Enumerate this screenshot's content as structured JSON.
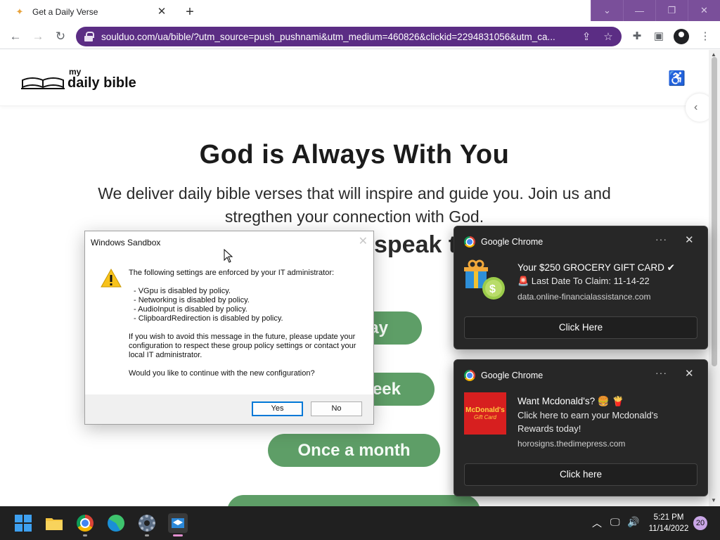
{
  "browser": {
    "tab_title": "Get a Daily Verse",
    "url": "soulduo.com/ua/bible/?utm_source=push_pushnami&utm_medium=460826&clickid=2294831056&utm_ca..."
  },
  "site": {
    "logo_small": "my",
    "logo_big": "daily bible",
    "hero_title": "God is Always With You",
    "hero_subtitle": "We deliver daily bible verses that will inspire and guide you. Join us and stregthen your connection with God.",
    "hero_question_partial": "speak t",
    "options": [
      "ay",
      "eek",
      "Once a month",
      ""
    ]
  },
  "dialog": {
    "title": "Windows Sandbox",
    "intro": "The following settings are enforced by your IT administrator:",
    "items": [
      "- VGpu is disabled by policy.",
      "- Networking is disabled by policy.",
      "- AudioInput is disabled by policy.",
      "- ClipboardRedirection is disabled by policy."
    ],
    "advice": "If you wish to avoid this message in the future, please update your configuration to respect these group policy settings or contact your local IT administrator.",
    "question": "Would you like to continue with the new configuration?",
    "yes_label": "Yes",
    "no_label": "No"
  },
  "notifications": [
    {
      "app": "Google Chrome",
      "title": "Your $250 GROCERY GIFT CARD ✔",
      "line": "🚨 Last Date To Claim: 11-14-22",
      "source": "data.online-financialassistance.com",
      "button": "Click Here"
    },
    {
      "app": "Google Chrome",
      "title": "Want Mcdonald's? 🍔 🍟",
      "line1": "Click here to earn your Mcdonald's",
      "line2": "Rewards today!",
      "source": "horosigns.thedimepress.com",
      "button": "Click here",
      "image_text_1": "McDonald's",
      "image_text_2": "Gift Card"
    }
  ],
  "taskbar": {
    "time": "5:21 PM",
    "date": "11/14/2022",
    "badge": "20"
  },
  "colors": {
    "omnibox": "#5b2d84",
    "option_green": "#5e9e67",
    "notification_bg": "#272727"
  }
}
